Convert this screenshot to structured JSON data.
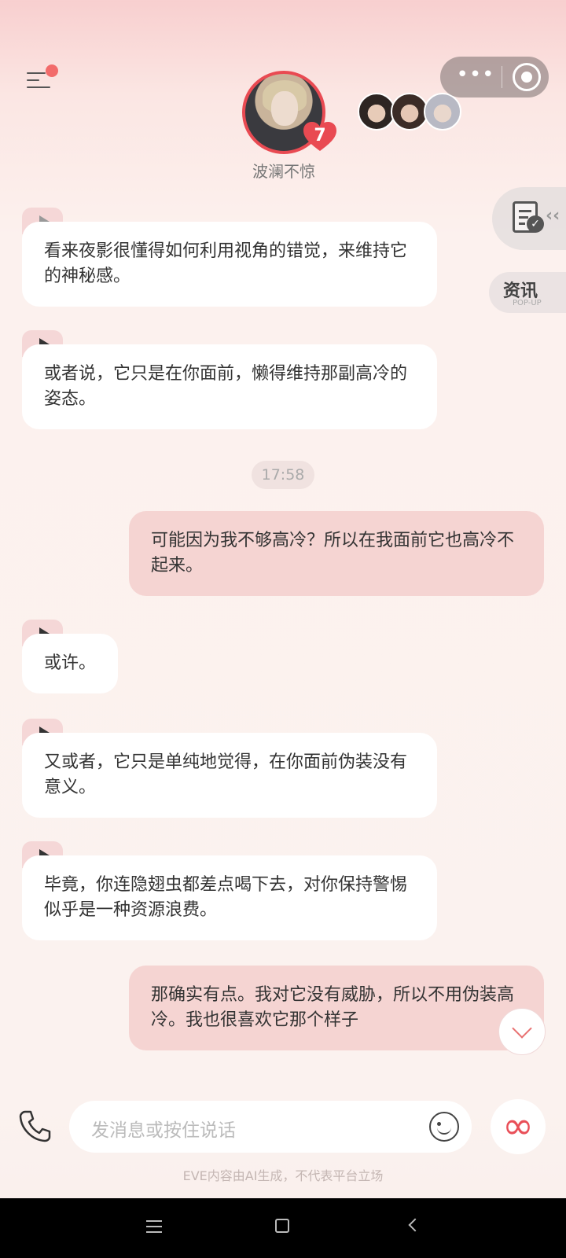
{
  "header": {
    "character_name": "波澜不惊",
    "affection_level": "7",
    "mini_avatar_count": 3
  },
  "side": {
    "news_label": "资讯",
    "news_sublabel": "POP-UP"
  },
  "messages": [
    {
      "from": "character",
      "text": "看来夜影很懂得如何利用视角的错觉，来维持它的神秘感。"
    },
    {
      "from": "character",
      "text": "或者说，它只是在你面前，懒得维持那副高冷的姿态。"
    },
    {
      "from": "user",
      "text": "可能因为我不够高冷？所以在我面前它也高冷不起来。"
    },
    {
      "from": "character",
      "text": "或许。"
    },
    {
      "from": "character",
      "text": "又或者，它只是单纯地觉得，在你面前伪装没有意义。"
    },
    {
      "from": "character",
      "text": "毕竟，你连隐翅虫都差点喝下去，对你保持警惕似乎是一种资源浪费。"
    },
    {
      "from": "user",
      "text": "那确实有点。我对它没有威胁，所以不用伪装高冷。我也很喜欢它那个样子"
    }
  ],
  "timestamp": "17:58",
  "input": {
    "placeholder": "发消息或按住说话"
  },
  "disclaimer": "EVE内容由AI生成，不代表平台立场",
  "colors": {
    "accent": "#e94a52",
    "user_bubble": "#f5d4d2",
    "character_bubble": "#ffffff"
  }
}
